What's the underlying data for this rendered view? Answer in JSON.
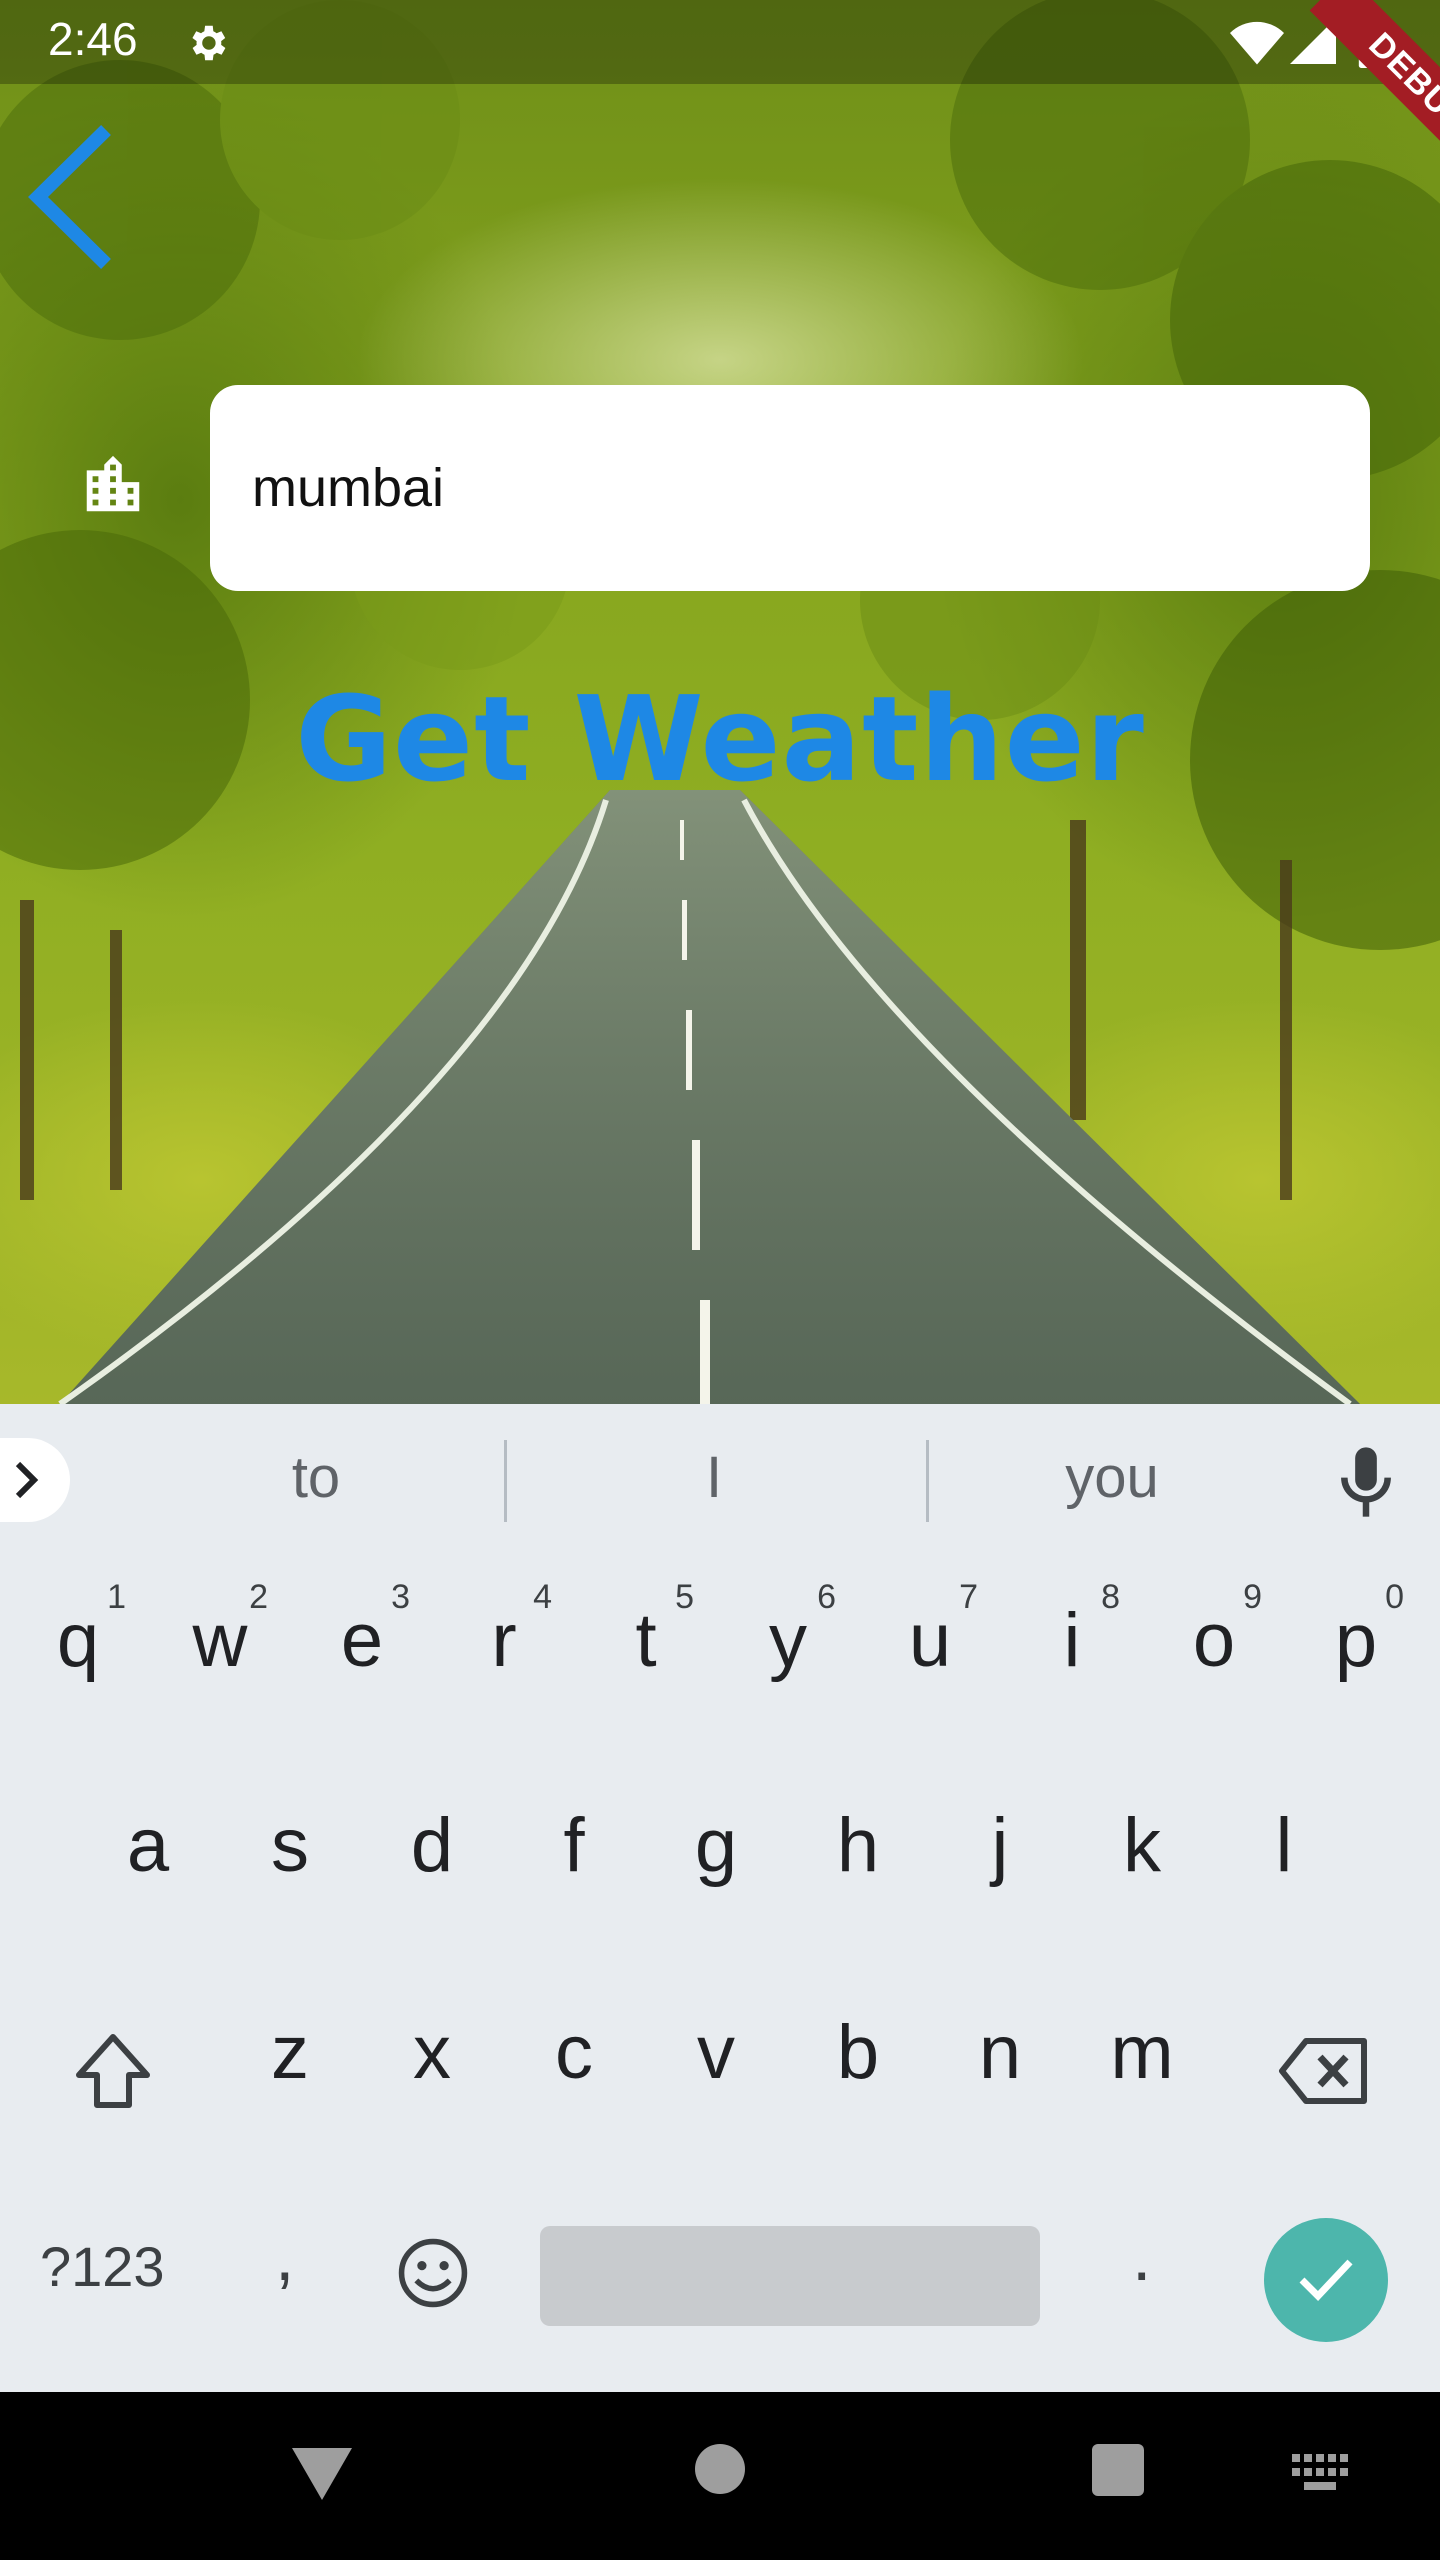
{
  "status_bar": {
    "time": "2:46",
    "debug_label": "DEBUG"
  },
  "search": {
    "value": "mumbai",
    "placeholder": ""
  },
  "action": {
    "label": "Get Weather"
  },
  "keyboard": {
    "suggestions": [
      "to",
      "I",
      "you"
    ],
    "row1": [
      {
        "key": "q",
        "hint": "1"
      },
      {
        "key": "w",
        "hint": "2"
      },
      {
        "key": "e",
        "hint": "3"
      },
      {
        "key": "r",
        "hint": "4"
      },
      {
        "key": "t",
        "hint": "5"
      },
      {
        "key": "y",
        "hint": "6"
      },
      {
        "key": "u",
        "hint": "7"
      },
      {
        "key": "i",
        "hint": "8"
      },
      {
        "key": "o",
        "hint": "9"
      },
      {
        "key": "p",
        "hint": "0"
      }
    ],
    "row2": [
      "a",
      "s",
      "d",
      "f",
      "g",
      "h",
      "j",
      "k",
      "l"
    ],
    "row3": [
      "z",
      "x",
      "c",
      "v",
      "b",
      "n",
      "m"
    ],
    "symbols_label": "?123",
    "comma": ",",
    "period": "."
  },
  "colors": {
    "accent": "#1e88e5",
    "enter_key": "#4db6ac",
    "debug_ribbon": "#a31d24"
  }
}
